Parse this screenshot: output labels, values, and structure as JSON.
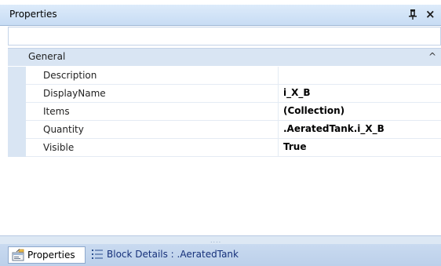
{
  "titlebar": {
    "title": "Properties",
    "pin_icon": "pin-icon",
    "close_icon": "close-icon",
    "close_glyph": "×"
  },
  "grid": {
    "category": {
      "label": "General",
      "icon": "chevron-up-icon",
      "glyph": "^"
    },
    "rows": [
      {
        "name": "Description",
        "value": ""
      },
      {
        "name": "DisplayName",
        "value": "i_X_B"
      },
      {
        "name": "Items",
        "value": "(Collection)"
      },
      {
        "name": "Quantity",
        "value": ".AeratedTank.i_X_B"
      },
      {
        "name": "Visible",
        "value": "True"
      }
    ]
  },
  "splitter": {
    "grip": "....",
    "icon": "grip-dots-icon"
  },
  "tabs": [
    {
      "label": "Properties",
      "icon": "properties-icon",
      "active": true
    },
    {
      "label": "Block Details : .AeratedTank",
      "icon": "list-icon",
      "active": false
    }
  ],
  "colors": {
    "titlebar": "#c7dcf4",
    "category_background": "#d9e5f3",
    "tabbar": "#bcd0ea",
    "inactive_tab_text": "#15307a"
  }
}
